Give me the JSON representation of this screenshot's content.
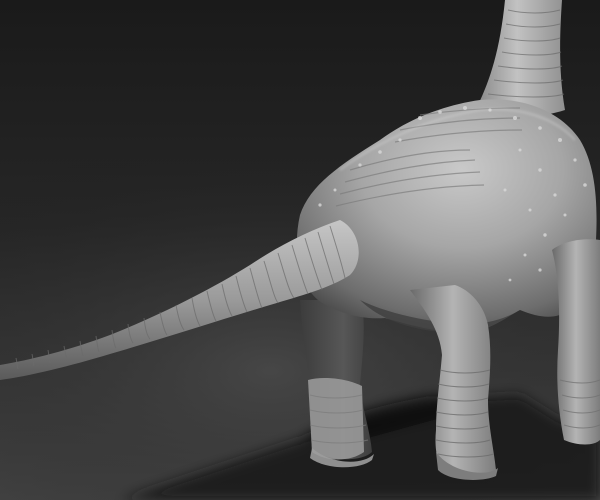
{
  "scene": {
    "subject": "sauropod-dinosaur-sculpt",
    "view": "rear-three-quarter",
    "colors": {
      "background_top": "#2b2b2b",
      "background_mid": "#3a3a3a",
      "background_floor": "#4a4a4a",
      "clay_light": "#bdbdbd",
      "clay_mid": "#8e8e8e",
      "clay_dark": "#4d4d4d",
      "shadow": "#161616"
    }
  }
}
